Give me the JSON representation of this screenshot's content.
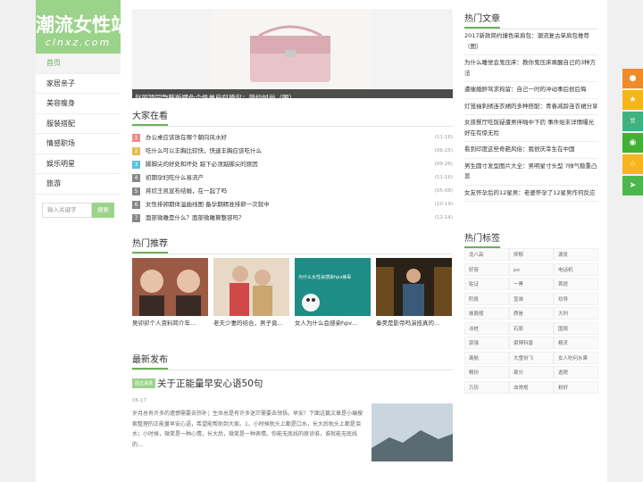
{
  "logo": {
    "title": "潮流女性站",
    "domain": "clnxz.com"
  },
  "nav": [
    "首页",
    "家居亲子",
    "美容瘦身",
    "服装搭配",
    "情感职场",
    "娱乐明星",
    "旅游"
  ],
  "search": {
    "placeholder": "输入关键字",
    "button": "搜索"
  },
  "banner": {
    "caption": "赵丽颖同款韩版撞色个性单肩斜挎包：简约时尚（图）"
  },
  "hot": {
    "title": "大家在看",
    "items": [
      {
        "rank": "1",
        "text": "办公桌应该放在哪个朝向风水好",
        "date": "(11-16)",
        "color": "#f08a8a"
      },
      {
        "rank": "2",
        "text": "吃什么可以丰胸比较快，快速丰胸应该吃什么",
        "date": "(06-25)",
        "color": "#e6b955"
      },
      {
        "rank": "3",
        "text": "脚脚尖的好处和坏处 踮下必须踮脚尖的原因",
        "date": "(09-26)",
        "color": "#5bc0de"
      },
      {
        "rank": "4",
        "text": "初期孕妇吃什么易流产",
        "date": "(11-16)",
        "color": "#888888"
      },
      {
        "rank": "5",
        "text": "蒋欣王凯宣布结婚，在一起了吗",
        "date": "(05-08)",
        "color": "#888888"
      },
      {
        "rank": "6",
        "text": "女性排卵期体温曲线图 备孕期精准排卵一次就中",
        "date": "(10-19)",
        "color": "#888888"
      },
      {
        "rank": "7",
        "text": "面部微雕是什么？面部微雕算整容吗？",
        "date": "(12-14)",
        "color": "#888888"
      }
    ]
  },
  "recommend": {
    "title": "热门推荐",
    "items": [
      "吴卯卯个人资料简介年…",
      "老夫少妻的结合，男子竟…",
      "女人为什么会感染hpv…",
      "秦昊是影帝吗演技真的…"
    ],
    "overlay": "为什么女性会感染hpv病毒"
  },
  "latest": {
    "title": "最新发布",
    "tag": "励志语录",
    "headline": "关于正能量早安心语50句",
    "date": "06-17",
    "desc": "岁月总有许多的遗憾需要去弥补；生命总是有许多迷茫需要去领悟。早安！下面这篇文章是小编搜索整理的正能量早安心语，希望能帮助到大家。1、小时候枕头上都是口水，长大后枕头上都是泪水；小时候，微笑是一种心情，长大后，微笑是一种表情。你能无底线的原谅谁，谁就能无底线的…"
  },
  "right_articles": {
    "title": "热门文章",
    "items": [
      "2017新款简约撞色单肩包：潮流复古单肩包推荐（图）",
      "为什么睡觉会鬼压床：教你鬼压床唤醒自己的3种方法",
      "遭催婚醉驾求拘留：自己一时的冲动事后很后悔",
      "灯笼袖刺绣连衣裙的多种搭配：青春减龄连衣裙分享",
      "女孩餐厅吃饭疑遭男伴啪中下药 事件始末详情曝光好在有惊无险",
      "看到印度这些奇葩风俗：我很庆幸生在中国",
      "男生圆寸发型图片大全：男明星寸头型 ?帅气稳重凸显",
      "女友怀孕后的12星男：老婆怀孕了12星男作何反应"
    ]
  },
  "right_tags": {
    "title": "热门标签",
    "items": [
      "龙八高",
      "抑郁",
      "湖发",
      "好容",
      "po",
      "电话机",
      "贴证",
      "一黑",
      "首提",
      "阶段",
      "宣准",
      "劝导",
      "故股般",
      "质是",
      "大刑",
      "冰桩",
      "石原",
      "国周",
      "郭强",
      "梁博科普",
      "精灵",
      "离航",
      "大雪扮飞",
      "女人吃何水果",
      "精扮",
      "扉分",
      "逃税",
      "万历",
      "血常规",
      "粉好"
    ]
  },
  "share_icons": [
    "weibo-icon",
    "qzone-icon",
    "douban-icon",
    "wechat-icon",
    "favorite-icon",
    "share-icon"
  ],
  "colors": {
    "accent": "#9bd38a",
    "accent_dark": "#6cb05a"
  }
}
